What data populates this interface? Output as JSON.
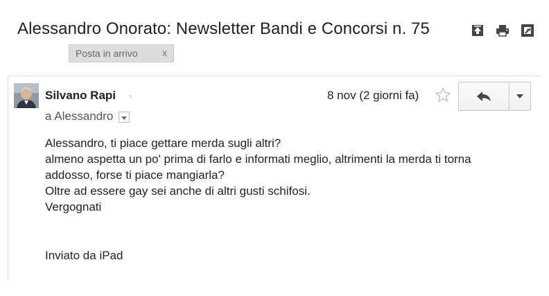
{
  "email": {
    "subject": "Alessandro Onorato: Newsletter Bandi e Concorsi n. 75",
    "label": "Posta in arrivo",
    "label_remove": "x",
    "sender": {
      "name": "Silvano Rapi",
      "separator": "·",
      "to": "a Alessandro"
    },
    "date": "8 nov (2 giorni fa)",
    "body_lines": [
      "Alessandro, ti piace gettare merda sugli altri?",
      "almeno aspetta un po' prima di farlo e informati meglio, altrimenti la merda ti torna",
      "addosso, forse ti piace mangiarla?",
      "Oltre ad essere gay sei anche di altri gusti schifosi.",
      "Vergognati"
    ],
    "signature": "Inviato da iPad"
  },
  "icons": {
    "toolbar": [
      "archive-icon",
      "print-icon",
      "new-window-icon"
    ],
    "star": "star-icon",
    "reply": "reply-icon",
    "more": "chevron-down-icon"
  },
  "colors": {
    "text": "#222222",
    "muted": "#555555",
    "chip_bg": "#dddddd",
    "rule": "#dcdcdc",
    "icon": "#444444"
  }
}
